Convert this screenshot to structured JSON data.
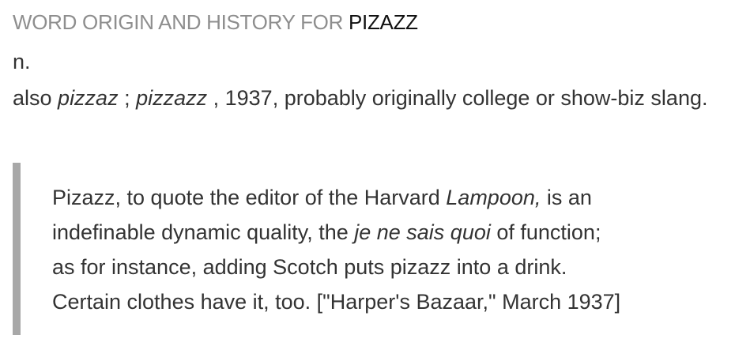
{
  "heading": {
    "prefix": "WORD ORIGIN AND HISTORY FOR ",
    "word": "PIZAZZ"
  },
  "part_of_speech": "n.",
  "body": {
    "lead": "also ",
    "variant1": "pizzaz",
    "sep": " ; ",
    "variant2": "pizzazz",
    "rest": " , 1937, probably originally college or show-biz slang."
  },
  "quote": {
    "line1_a": "Pizazz, to quote the editor of the Harvard ",
    "line1_italic": "Lampoon,",
    "line1_b": " is an",
    "line2_a": "indefinable dynamic quality, the ",
    "line2_italic": "je ne sais quoi",
    "line2_b": " of function;",
    "line3": "as for instance, adding Scotch puts pizazz into a drink.",
    "line4": "Certain clothes have it, too. [\"Harper's Bazaar,\" March 1937]"
  },
  "colors": {
    "heading_gray": "#8e8e8e",
    "heading_word": "#111111",
    "text": "#333333",
    "quote_bar": "#a8a8a8"
  }
}
